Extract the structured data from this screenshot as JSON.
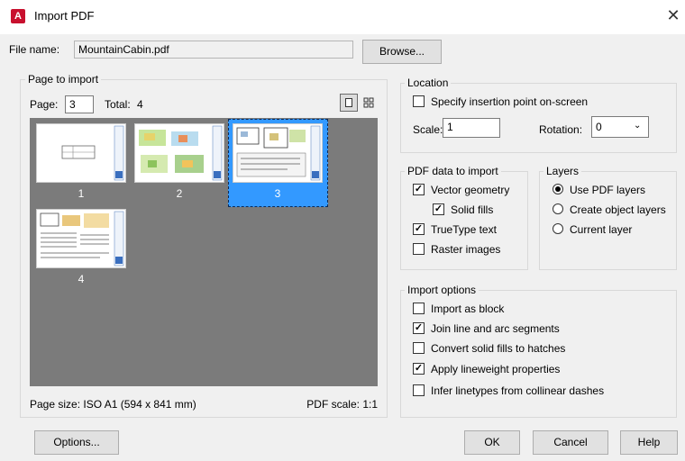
{
  "window": {
    "title": "Import PDF",
    "app_icon_letter": "A"
  },
  "file": {
    "label": "File name:",
    "value": "MountainCabin.pdf",
    "browse": "Browse..."
  },
  "page_import": {
    "group_label": "Page to import",
    "page_label": "Page:",
    "page_value": "3",
    "total_label": "Total:",
    "total_value": "4",
    "thumbnails": [
      {
        "num": "1"
      },
      {
        "num": "2"
      },
      {
        "num": "3"
      },
      {
        "num": "4"
      }
    ],
    "selected": "3",
    "page_size": "Page size: ISO A1 (594 x 841 mm)",
    "pdf_scale": "PDF scale: 1:1"
  },
  "location": {
    "group_label": "Location",
    "specify": "Specify insertion point on-screen",
    "scale_label": "Scale:",
    "scale_value": "1",
    "rotation_label": "Rotation:",
    "rotation_value": "0"
  },
  "pdf_data": {
    "group_label": "PDF data to import",
    "vector": "Vector geometry",
    "solid_fills": "Solid fills",
    "truetype": "TrueType text",
    "raster": "Raster images"
  },
  "layers": {
    "group_label": "Layers",
    "use_pdf": "Use PDF layers",
    "create_object": "Create object layers",
    "current": "Current layer"
  },
  "import_options": {
    "group_label": "Import options",
    "as_block": "Import as block",
    "join": "Join line and arc segments",
    "convert": "Convert solid fills to hatches",
    "lineweight": "Apply lineweight properties",
    "infer": "Infer linetypes from collinear dashes"
  },
  "buttons": {
    "options": "Options...",
    "ok": "OK",
    "cancel": "Cancel",
    "help": "Help"
  },
  "colors": {
    "selection": "#3399ff",
    "preview_bg": "#7b7b7b",
    "logo": "#c8102e"
  }
}
